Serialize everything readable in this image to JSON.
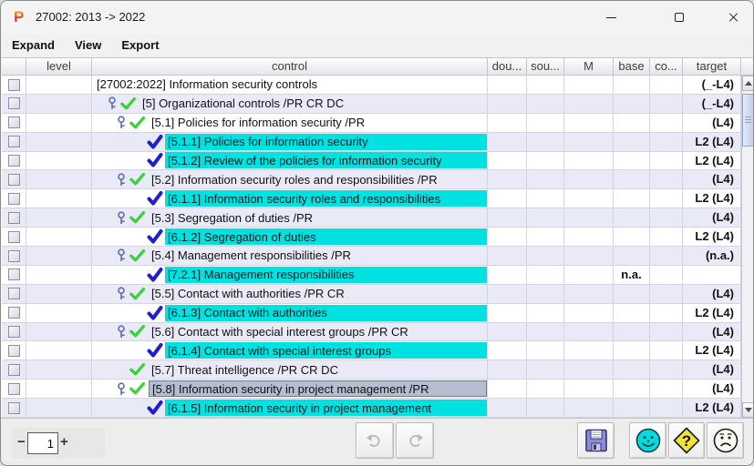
{
  "window": {
    "logo_letter": "P",
    "title": "27002: 2013 -> 2022"
  },
  "menu": {
    "items": [
      "Expand",
      "View",
      "Export"
    ]
  },
  "table": {
    "columns": [
      "",
      "level",
      "control",
      "dou...",
      "sou...",
      "M",
      "base",
      "co...",
      "target",
      ""
    ],
    "rows": [
      {
        "level": 0,
        "key": false,
        "green_check": false,
        "blue_check": false,
        "highlight": "none",
        "control": "[27002:2022] Information security controls",
        "base": "",
        "target": "(_-L4)"
      },
      {
        "level": 1,
        "key": true,
        "green_check": true,
        "blue_check": false,
        "highlight": "none",
        "control": "[5] Organizational controls /PR CR DC",
        "base": "",
        "target": "(_-L4)"
      },
      {
        "level": 2,
        "key": true,
        "green_check": true,
        "blue_check": false,
        "highlight": "none",
        "control": "[5.1] Policies for information security /PR",
        "base": "",
        "target": "(L4)"
      },
      {
        "level": 3,
        "key": false,
        "green_check": false,
        "blue_check": true,
        "highlight": "cyan",
        "control": "[5.1.1] Policies for information security",
        "base": "",
        "target": "L2 (L4)"
      },
      {
        "level": 3,
        "key": false,
        "green_check": false,
        "blue_check": true,
        "highlight": "cyan",
        "control": "[5.1.2] Review of the policies for information security",
        "base": "",
        "target": "L2 (L4)"
      },
      {
        "level": 2,
        "key": true,
        "green_check": true,
        "blue_check": false,
        "highlight": "none",
        "control": "[5.2] Information security roles and responsibilities /PR",
        "base": "",
        "target": "(L4)"
      },
      {
        "level": 3,
        "key": false,
        "green_check": false,
        "blue_check": true,
        "highlight": "cyan",
        "control": "[6.1.1] Information security roles and responsibilities",
        "base": "",
        "target": "L2 (L4)"
      },
      {
        "level": 2,
        "key": true,
        "green_check": true,
        "blue_check": false,
        "highlight": "none",
        "control": "[5.3] Segregation of duties /PR",
        "base": "",
        "target": "(L4)"
      },
      {
        "level": 3,
        "key": false,
        "green_check": false,
        "blue_check": true,
        "highlight": "cyan",
        "control": "[6.1.2] Segregation of duties",
        "base": "",
        "target": "L2 (L4)"
      },
      {
        "level": 2,
        "key": true,
        "green_check": true,
        "blue_check": false,
        "highlight": "none",
        "control": "[5.4] Management responsibilities /PR",
        "base": "",
        "target": "(n.a.)"
      },
      {
        "level": 3,
        "key": false,
        "green_check": false,
        "blue_check": true,
        "highlight": "cyan",
        "control": "[7.2.1] Management responsibilities",
        "base": "n.a.",
        "target": ""
      },
      {
        "level": 2,
        "key": true,
        "green_check": true,
        "blue_check": false,
        "highlight": "none",
        "control": "[5.5] Contact with authorities /PR CR",
        "base": "",
        "target": "(L4)"
      },
      {
        "level": 3,
        "key": false,
        "green_check": false,
        "blue_check": true,
        "highlight": "cyan",
        "control": "[6.1.3] Contact with authorities",
        "base": "",
        "target": "L2 (L4)"
      },
      {
        "level": 2,
        "key": true,
        "green_check": true,
        "blue_check": false,
        "highlight": "none",
        "control": "[5.6] Contact with special interest groups /PR CR",
        "base": "",
        "target": "(L4)"
      },
      {
        "level": 3,
        "key": false,
        "green_check": false,
        "blue_check": true,
        "highlight": "cyan",
        "control": "[6.1.4] Contact with special interest groups",
        "base": "",
        "target": "L2 (L4)"
      },
      {
        "level": 2,
        "key": false,
        "green_check": true,
        "blue_check": false,
        "highlight": "none",
        "control": "[5.7] Threat intelligence /PR CR DC",
        "base": "",
        "target": "(L4)"
      },
      {
        "level": 2,
        "key": true,
        "green_check": true,
        "blue_check": false,
        "highlight": "selected",
        "control": "[5.8] Information security in project management /PR",
        "base": "",
        "target": "(L4)"
      },
      {
        "level": 3,
        "key": false,
        "green_check": false,
        "blue_check": true,
        "highlight": "cyan",
        "control": "[6.1.5] Information security in project management",
        "base": "",
        "target": "L2 (L4)"
      }
    ]
  },
  "footer": {
    "zoom_minus": "−",
    "zoom_value": "1",
    "zoom_plus": "+"
  },
  "colors": {
    "cyan_highlight": "#00e1e1",
    "row_alt": "#e9e9f7",
    "selection_fill": "#b5becf",
    "selection_border": "#6e7a92",
    "green_check": "#37d337",
    "blue_check": "#1f1fd0",
    "key_icon": "#5b6fb0",
    "save_purple": "#8c8cd6",
    "smiley_cyan": "#00dcdc",
    "question_yellow": "#f2e435"
  }
}
